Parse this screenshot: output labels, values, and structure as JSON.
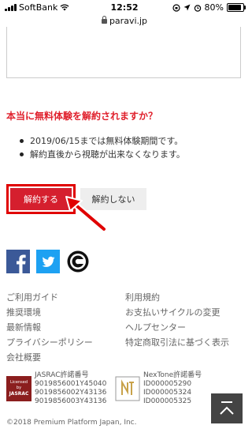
{
  "status_bar": {
    "carrier": "SoftBank",
    "time": "12:52",
    "battery": "80%",
    "battery_level": 0.8
  },
  "url_bar": {
    "domain": "paravi.jp"
  },
  "question": "本当に無料体験を解約されますか？",
  "bullets": [
    "2019/06/15までは無料体験期間です。",
    "解約直後から視聴が出来なくなります。"
  ],
  "buttons": {
    "cancel": "解約する",
    "keep": "解約しない"
  },
  "footer": {
    "links_left": [
      "ご利用ガイド",
      "推奨環境",
      "最新情報",
      "プライバシーポリシー",
      "会社概要"
    ],
    "links_right": [
      "利用規約",
      "お支払いサイクルの変更",
      "ヘルプセンター",
      "特定商取引法に基づく表示"
    ],
    "jasrac": {
      "title": "JASRAC許諾番号",
      "numbers": [
        "9019856001Y45040",
        "9019856002Y43136",
        "9019856003Y43136"
      ],
      "logo_text": [
        "Licensed",
        "by",
        "JASRAC"
      ]
    },
    "nextone": {
      "title": "NexTone許諾番号",
      "numbers": [
        "ID000005290",
        "ID000005324",
        "ID000005325"
      ]
    },
    "copyright": "©2018 Premium Platform Japan, Inc."
  },
  "colors": {
    "accent_red": "#d51f2e",
    "highlight_red": "#e00000",
    "facebook": "#3b5998",
    "twitter": "#1da1f2"
  },
  "icons": [
    "facebook-icon",
    "twitter-icon",
    "c-logo-icon",
    "scroll-top-icon",
    "lock-icon",
    "wifi-icon"
  ]
}
